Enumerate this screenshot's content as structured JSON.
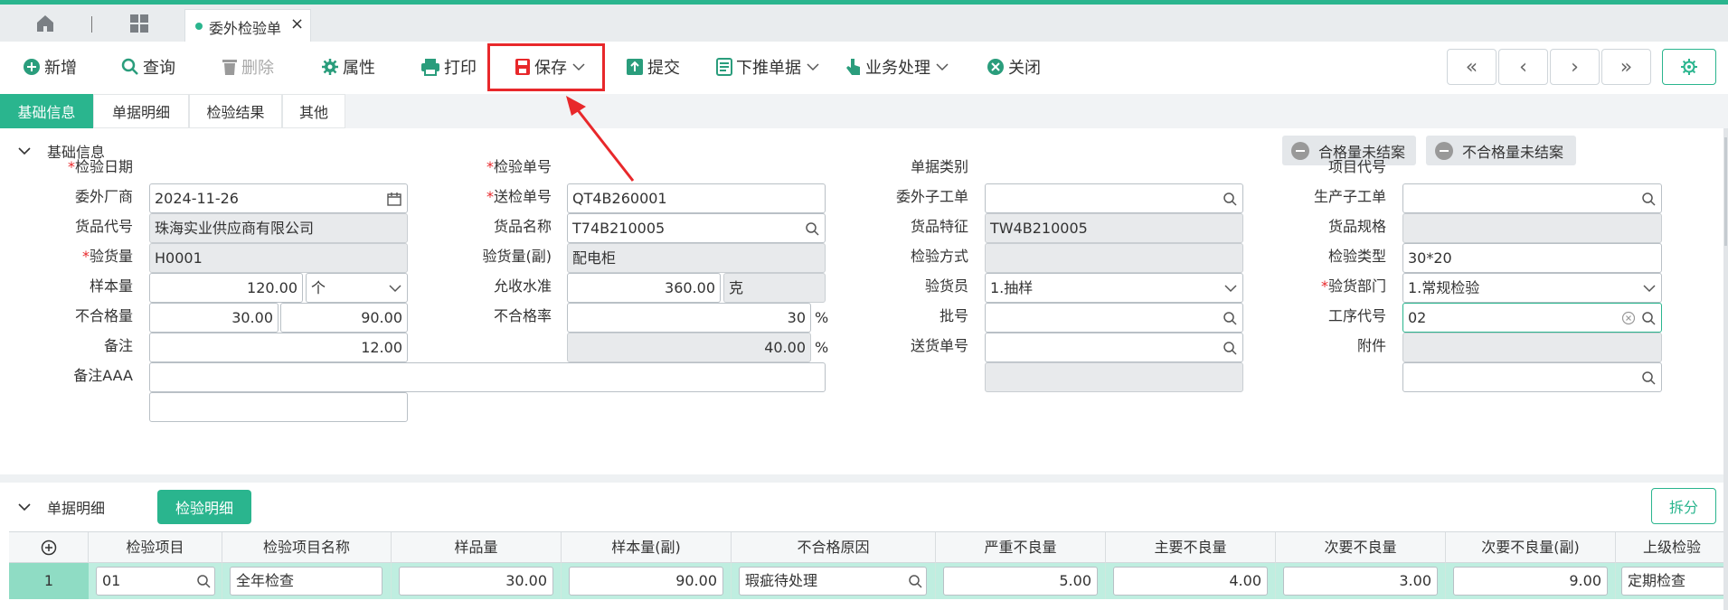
{
  "tabbar": {
    "active_tab": "委外检验单"
  },
  "toolbar": {
    "add": "新增",
    "query": "查询",
    "delete": "删除",
    "properties": "属性",
    "print": "打印",
    "save": "保存",
    "submit": "提交",
    "push_down": "下推单据",
    "business": "业务处理",
    "close": "关闭"
  },
  "section_tabs": [
    "基础信息",
    "单据明细",
    "检验结果",
    "其他"
  ],
  "basic": {
    "title": "基础信息",
    "btn_qualified": "合格量未结案",
    "btn_unqualified": "不合格量未结案",
    "labels": {
      "inspect_date": "检验日期",
      "inspect_no": "检验单号",
      "doc_type": "单据类别",
      "project_code": "项目代号",
      "vendor": "委外厂商",
      "send_no": "送检单号",
      "sub_order": "委外子工单",
      "prod_order": "生产子工单",
      "item_code": "货品代号",
      "item_name": "货品名称",
      "item_feature": "货品特征",
      "item_spec": "货品规格",
      "qty": "验货量",
      "qty_aux": "验货量(副)",
      "method": "检验方式",
      "type": "检验类型",
      "sample": "样本量",
      "aql": "允收水准",
      "inspector": "验货员",
      "dept": "验货部门",
      "ng_qty": "不合格量",
      "ng_rate": "不合格率",
      "lot": "批号",
      "process": "工序代号",
      "remark": "备注",
      "delivery_no": "送货单号",
      "attach": "附件",
      "remark_aaa": "备注AAA"
    },
    "values": {
      "inspect_date": "2024-11-26",
      "inspect_no": "QT4B260001",
      "vendor": "珠海实业供应商有限公司",
      "send_no": "T74B210005",
      "sub_order": "TW4B210005",
      "item_code": "H0001",
      "item_name": "配电柜",
      "item_spec": "30*20",
      "qty": "120.00",
      "qty_unit": "个",
      "qty_aux": "360.00",
      "qty_aux_unit": "克",
      "method": "1.抽样",
      "type": "1.常规检验",
      "sample": "30.00",
      "sample_aux": "90.00",
      "aql": "30",
      "dept": "02",
      "ng_qty": "12.00",
      "ng_rate": "40.00",
      "percent": "%"
    }
  },
  "detail": {
    "title": "单据明细",
    "tab": "检验明细",
    "split": "拆分",
    "columns": [
      "检验项目",
      "检验项目名称",
      "样品量",
      "样本量(副)",
      "不合格原因",
      "严重不良量",
      "主要不良量",
      "次要不良量",
      "次要不良量(副)",
      "上级检验"
    ],
    "rows": [
      {
        "no": "1",
        "item": "01",
        "name": "全年检查",
        "sample": "30.00",
        "sample_aux": "90.00",
        "reason": "瑕疵待处理",
        "critical": "5.00",
        "major": "4.00",
        "minor": "3.00",
        "minor_aux": "9.00",
        "parent": "定期检查"
      }
    ]
  },
  "colors": {
    "accent": "#2ab58e",
    "highlight": "#e8282b"
  }
}
